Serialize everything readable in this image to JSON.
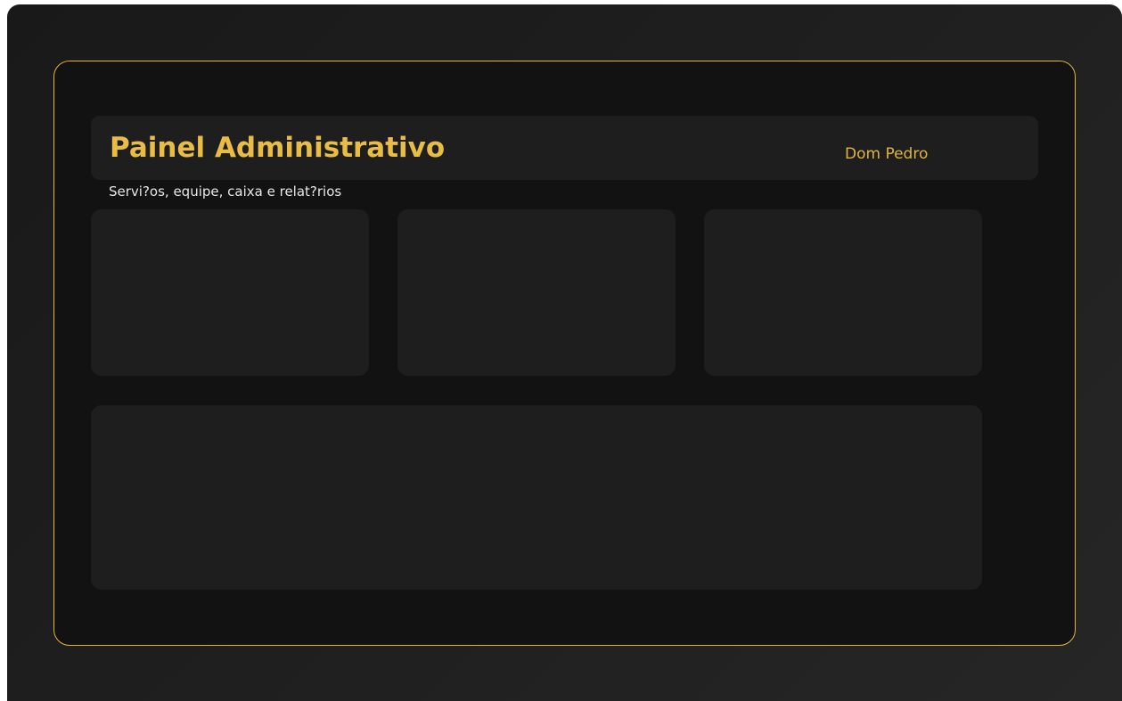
{
  "header": {
    "title": "Painel Administrativo",
    "user_name": "Dom Pedro",
    "subtitle": "Servi?os, equipe, caixa e relat?rios"
  },
  "colors": {
    "accent": "#e0b53d",
    "background": "#121212",
    "card": "#1e1e1e",
    "text": "#e6e6e6"
  },
  "cards": [
    {
      "id": "card-1"
    },
    {
      "id": "card-2"
    },
    {
      "id": "card-3"
    }
  ]
}
